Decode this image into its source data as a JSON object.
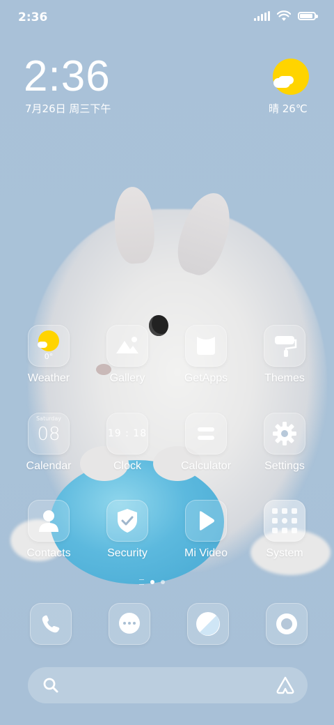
{
  "status_bar": {
    "time": "2:36",
    "signal_icon": "signal-icon",
    "wifi_icon": "wifi-icon",
    "battery_icon": "battery-icon",
    "battery_level": 0.9
  },
  "clock_widget": {
    "time": "2:36",
    "date": "7月26日 周三下午"
  },
  "weather_widget": {
    "icon": "sun-cloud-icon",
    "text": "晴 26℃",
    "sun_color": "#ffd400"
  },
  "apps": [
    {
      "label": "Weather",
      "icon": "weather-icon",
      "detail": "0°"
    },
    {
      "label": "Gallery",
      "icon": "gallery-icon"
    },
    {
      "label": "GetApps",
      "icon": "getapps-icon"
    },
    {
      "label": "Themes",
      "icon": "themes-icon"
    },
    {
      "label": "Calendar",
      "icon": "calendar-icon",
      "detail": "08",
      "sub": "Saturday"
    },
    {
      "label": "Clock",
      "icon": "clock-icon",
      "detail": "19 : 18"
    },
    {
      "label": "Calculator",
      "icon": "calculator-icon"
    },
    {
      "label": "Settings",
      "icon": "gear-icon"
    },
    {
      "label": "Contacts",
      "icon": "contacts-icon"
    },
    {
      "label": "Security",
      "icon": "shield-icon"
    },
    {
      "label": "Mi Video",
      "icon": "play-icon"
    },
    {
      "label": "System",
      "icon": "folder-icon"
    }
  ],
  "page_indicator": {
    "count": 2,
    "active": 1
  },
  "dock": [
    {
      "icon": "phone-icon"
    },
    {
      "icon": "message-icon"
    },
    {
      "icon": "browser-icon"
    },
    {
      "icon": "camera-icon"
    }
  ],
  "search": {
    "search_icon": "search-icon",
    "assistant_icon": "assistant-icon"
  }
}
